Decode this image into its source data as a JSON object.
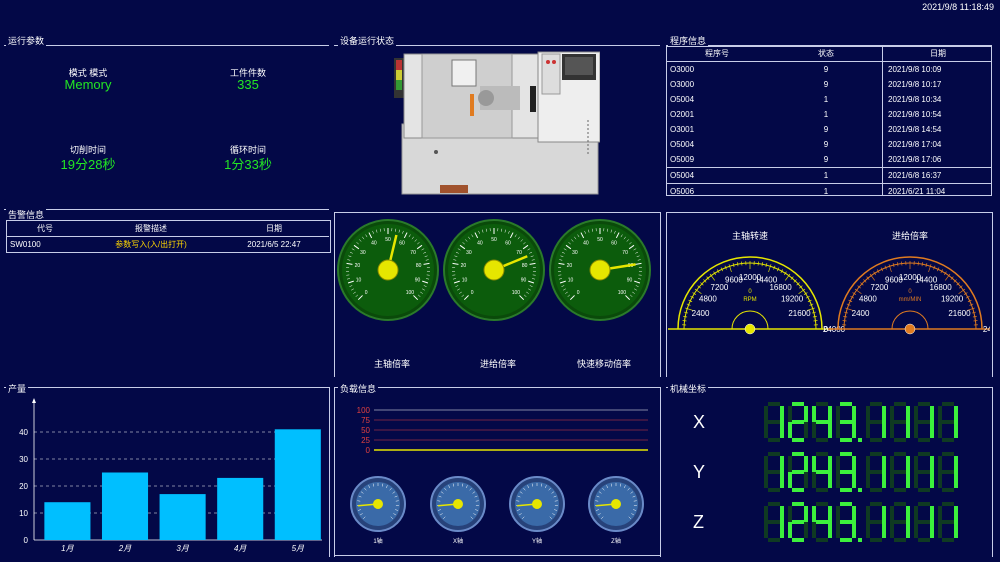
{
  "header": {
    "datetime": "2021/9/8 11:18:49"
  },
  "run_params": {
    "title": "运行参数",
    "mode_label": "模式 模式",
    "mode_value": "Memory",
    "parts_label": "工件件数",
    "parts_value": "335",
    "cut_time_label": "切削时间",
    "cut_time_value": "19分28秒",
    "cycle_time_label": "循环时间",
    "cycle_time_value": "1分33秒"
  },
  "equipment": {
    "title": "设备运行状态"
  },
  "program": {
    "title": "程序信息",
    "headers": [
      "程序号",
      "状态",
      "日期"
    ],
    "rows": [
      [
        "O3000",
        "9",
        "2021/9/8 10:09"
      ],
      [
        "O3000",
        "9",
        "2021/9/8 10:17"
      ],
      [
        "O5004",
        "1",
        "2021/9/8 10:34"
      ],
      [
        "O2001",
        "1",
        "2021/9/8 10:54"
      ],
      [
        "O3001",
        "9",
        "2021/9/8 14:54"
      ],
      [
        "O5004",
        "9",
        "2021/9/8 17:04"
      ],
      [
        "O5009",
        "9",
        "2021/9/8 17:06"
      ],
      [
        "O5004",
        "1",
        "2021/6/8 16:37"
      ],
      [
        "O5006",
        "1",
        "2021/6/21 11:04"
      ]
    ]
  },
  "alarm": {
    "title": "告警信息",
    "headers": [
      "代号",
      "报警描述",
      "日期"
    ],
    "rows": [
      [
        "SW0100",
        "参数写入(入/出打开)",
        "2021/6/5 22:47"
      ]
    ]
  },
  "overrides": {
    "labels": [
      "主轴倍率",
      "进给倍率",
      "快速移动倍率"
    ],
    "values": [
      55,
      75,
      80
    ]
  },
  "speed": {
    "spindle_title": "主轴转速",
    "feed_title": "进给倍率",
    "spindle_unit": "RPM",
    "feed_unit": "mm/MIN",
    "scale": [
      "0",
      "2400",
      "4800",
      "7200",
      "9600",
      "12000",
      "14400",
      "16800",
      "19200",
      "21600",
      "24000"
    ],
    "spindle_zero": "0",
    "feed_zero": "0"
  },
  "production": {
    "title": "产量"
  },
  "load": {
    "title": "负载信息",
    "scale": [
      "100",
      "75",
      "50",
      "25",
      "0"
    ],
    "gauges": [
      "1轴",
      "X轴",
      "Y轴",
      "Z轴"
    ]
  },
  "coords": {
    "title": "机械坐标",
    "axes": [
      {
        "name": "X",
        "value": "1243.1111"
      },
      {
        "name": "Y",
        "value": "1243.1111"
      },
      {
        "name": "Z",
        "value": "1243.1111"
      }
    ]
  },
  "chart_data": {
    "type": "bar",
    "categories": [
      "1月",
      "2月",
      "3月",
      "4月",
      "5月"
    ],
    "values": [
      14,
      25,
      17,
      23,
      41
    ],
    "ylim": [
      0,
      50
    ],
    "yticks": [
      0,
      10,
      20,
      30,
      40
    ],
    "color": "#00bfff"
  },
  "colors": {
    "bg": "#030847",
    "green": "#23e623",
    "seg_on": "#3cf03c",
    "seg_off": "#0f3a22",
    "bar": "#00bfff",
    "gauge_face": "#0c5c0c",
    "needle": "#e6e600"
  }
}
